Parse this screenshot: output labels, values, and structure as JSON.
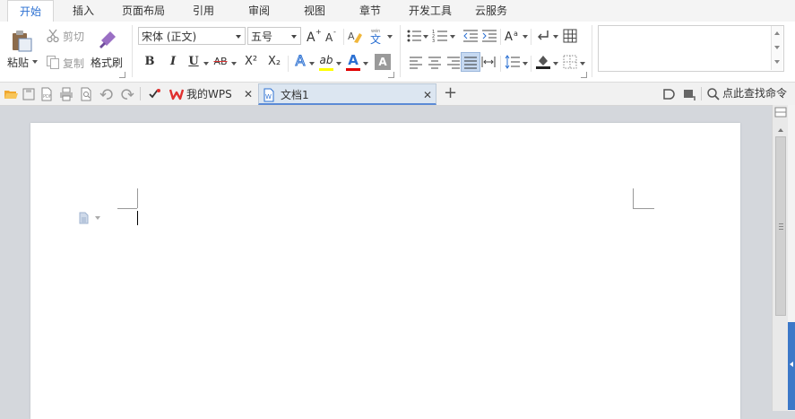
{
  "menu": {
    "tabs": [
      {
        "label": "开始",
        "active": true
      },
      {
        "label": "插入"
      },
      {
        "label": "页面布局"
      },
      {
        "label": "引用"
      },
      {
        "label": "审阅"
      },
      {
        "label": "视图"
      },
      {
        "label": "章节"
      },
      {
        "label": "开发工具"
      },
      {
        "label": "云服务"
      }
    ]
  },
  "ribbon": {
    "clipboard": {
      "paste_label": "粘贴",
      "cut_label": "剪切",
      "copy_label": "复制",
      "format_painter_label": "格式刷"
    },
    "font": {
      "font_name": "宋体 (正文)",
      "font_size": "五号",
      "wen_glyph": "文",
      "bold": "B",
      "italic": "I",
      "underline": "U",
      "strike": "AB",
      "superscript": "X²",
      "subscript": "X₂",
      "text_effect": "A",
      "highlight": "ab",
      "font_color": "A",
      "char_shading": "A"
    }
  },
  "qbar": {
    "doc_tabs": [
      {
        "label": "我的WPS"
      },
      {
        "label": "文档1",
        "active": true
      }
    ],
    "new_tab": "+",
    "search_label": "点此查找命令"
  },
  "colors": {
    "accent": "#2b70d2",
    "wps_red": "#e0302f",
    "font_color_bar": "#e00000",
    "highlight_bar": "#ffff00"
  }
}
